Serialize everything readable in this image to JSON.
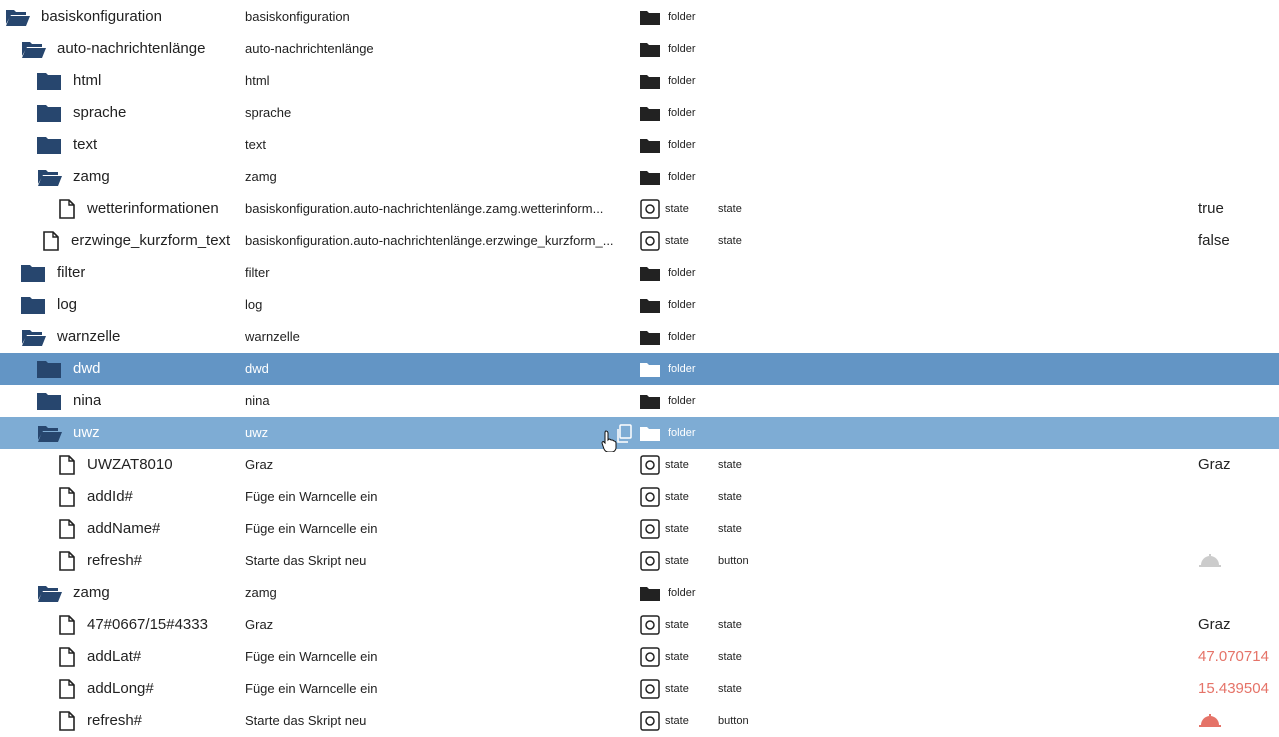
{
  "colors": {
    "folder_fill": "#27466e",
    "selected_dark": "#6395c5",
    "selected_light": "#7eacd4",
    "value_red": "#e57368"
  },
  "rows": [
    {
      "name": "basiskonfiguration",
      "display_name": "basiskonfiguration",
      "type": "folder",
      "icon": "folder-open-icon"
    },
    {
      "name": "auto-nachrichtenlänge",
      "display_name": "auto-nachrichtenlänge",
      "type": "folder",
      "icon": "folder-open-icon"
    },
    {
      "name": "html",
      "display_name": "html",
      "type": "folder",
      "icon": "folder-closed-icon"
    },
    {
      "name": "sprache",
      "display_name": "sprache",
      "type": "folder",
      "icon": "folder-closed-icon"
    },
    {
      "name": "text",
      "display_name": "text",
      "type": "folder",
      "icon": "folder-closed-icon"
    },
    {
      "name": "zamg",
      "display_name": "zamg",
      "type": "folder",
      "icon": "folder-open-icon"
    },
    {
      "name": "wetterinformationen",
      "display_name": "basiskonfiguration.auto-nachrichtenlänge.zamg.wetterinform...",
      "type": "state",
      "role": "state",
      "value": "true",
      "icon": "file-icon"
    },
    {
      "name": "erzwinge_kurzform_text",
      "display_name": "basiskonfiguration.auto-nachrichtenlänge.erzwinge_kurzform_...",
      "type": "state",
      "role": "state",
      "value": "false",
      "icon": "file-icon"
    },
    {
      "name": "filter",
      "display_name": "filter",
      "type": "folder",
      "icon": "folder-closed-icon"
    },
    {
      "name": "log",
      "display_name": "log",
      "type": "folder",
      "icon": "folder-closed-icon"
    },
    {
      "name": "warnzelle",
      "display_name": "warnzelle",
      "type": "folder",
      "icon": "folder-open-icon"
    },
    {
      "name": "dwd",
      "display_name": "dwd",
      "type": "folder",
      "icon": "folder-closed-icon",
      "selected": "dark"
    },
    {
      "name": "nina",
      "display_name": "nina",
      "type": "folder",
      "icon": "folder-closed-icon"
    },
    {
      "name": "uwz",
      "display_name": "uwz",
      "type": "folder",
      "icon": "folder-open-icon",
      "selected": "light"
    },
    {
      "name": "UWZAT8010",
      "display_name": "Graz",
      "type": "state",
      "role": "state",
      "value": "Graz",
      "icon": "file-icon"
    },
    {
      "name": "addId#",
      "display_name": "Füge ein Warncelle ein",
      "type": "state",
      "role": "state",
      "value": "",
      "icon": "file-icon"
    },
    {
      "name": "addName#",
      "display_name": "Füge ein Warncelle ein",
      "type": "state",
      "role": "state",
      "value": "",
      "icon": "file-icon"
    },
    {
      "name": "refresh#",
      "display_name": "Starte das Skript neu",
      "type": "state",
      "role": "button",
      "value": "",
      "icon": "file-icon",
      "bell": "grey"
    },
    {
      "name": "zamg",
      "display_name": "zamg",
      "type": "folder",
      "icon": "folder-open-icon"
    },
    {
      "name": "47#0667/15#4333",
      "display_name": "Graz",
      "type": "state",
      "role": "state",
      "value": "Graz",
      "icon": "file-icon"
    },
    {
      "name": "addLat#",
      "display_name": "Füge ein Warncelle ein",
      "type": "state",
      "role": "state",
      "value": "47.070714",
      "value_color": "red",
      "icon": "file-icon"
    },
    {
      "name": "addLong#",
      "display_name": "Füge ein Warncelle ein",
      "type": "state",
      "role": "state",
      "value": "15.439504",
      "value_color": "red",
      "icon": "file-icon"
    },
    {
      "name": "refresh#",
      "display_name": "Starte das Skript neu",
      "type": "state",
      "role": "button",
      "value": "",
      "icon": "file-icon",
      "bell": "red"
    }
  ]
}
